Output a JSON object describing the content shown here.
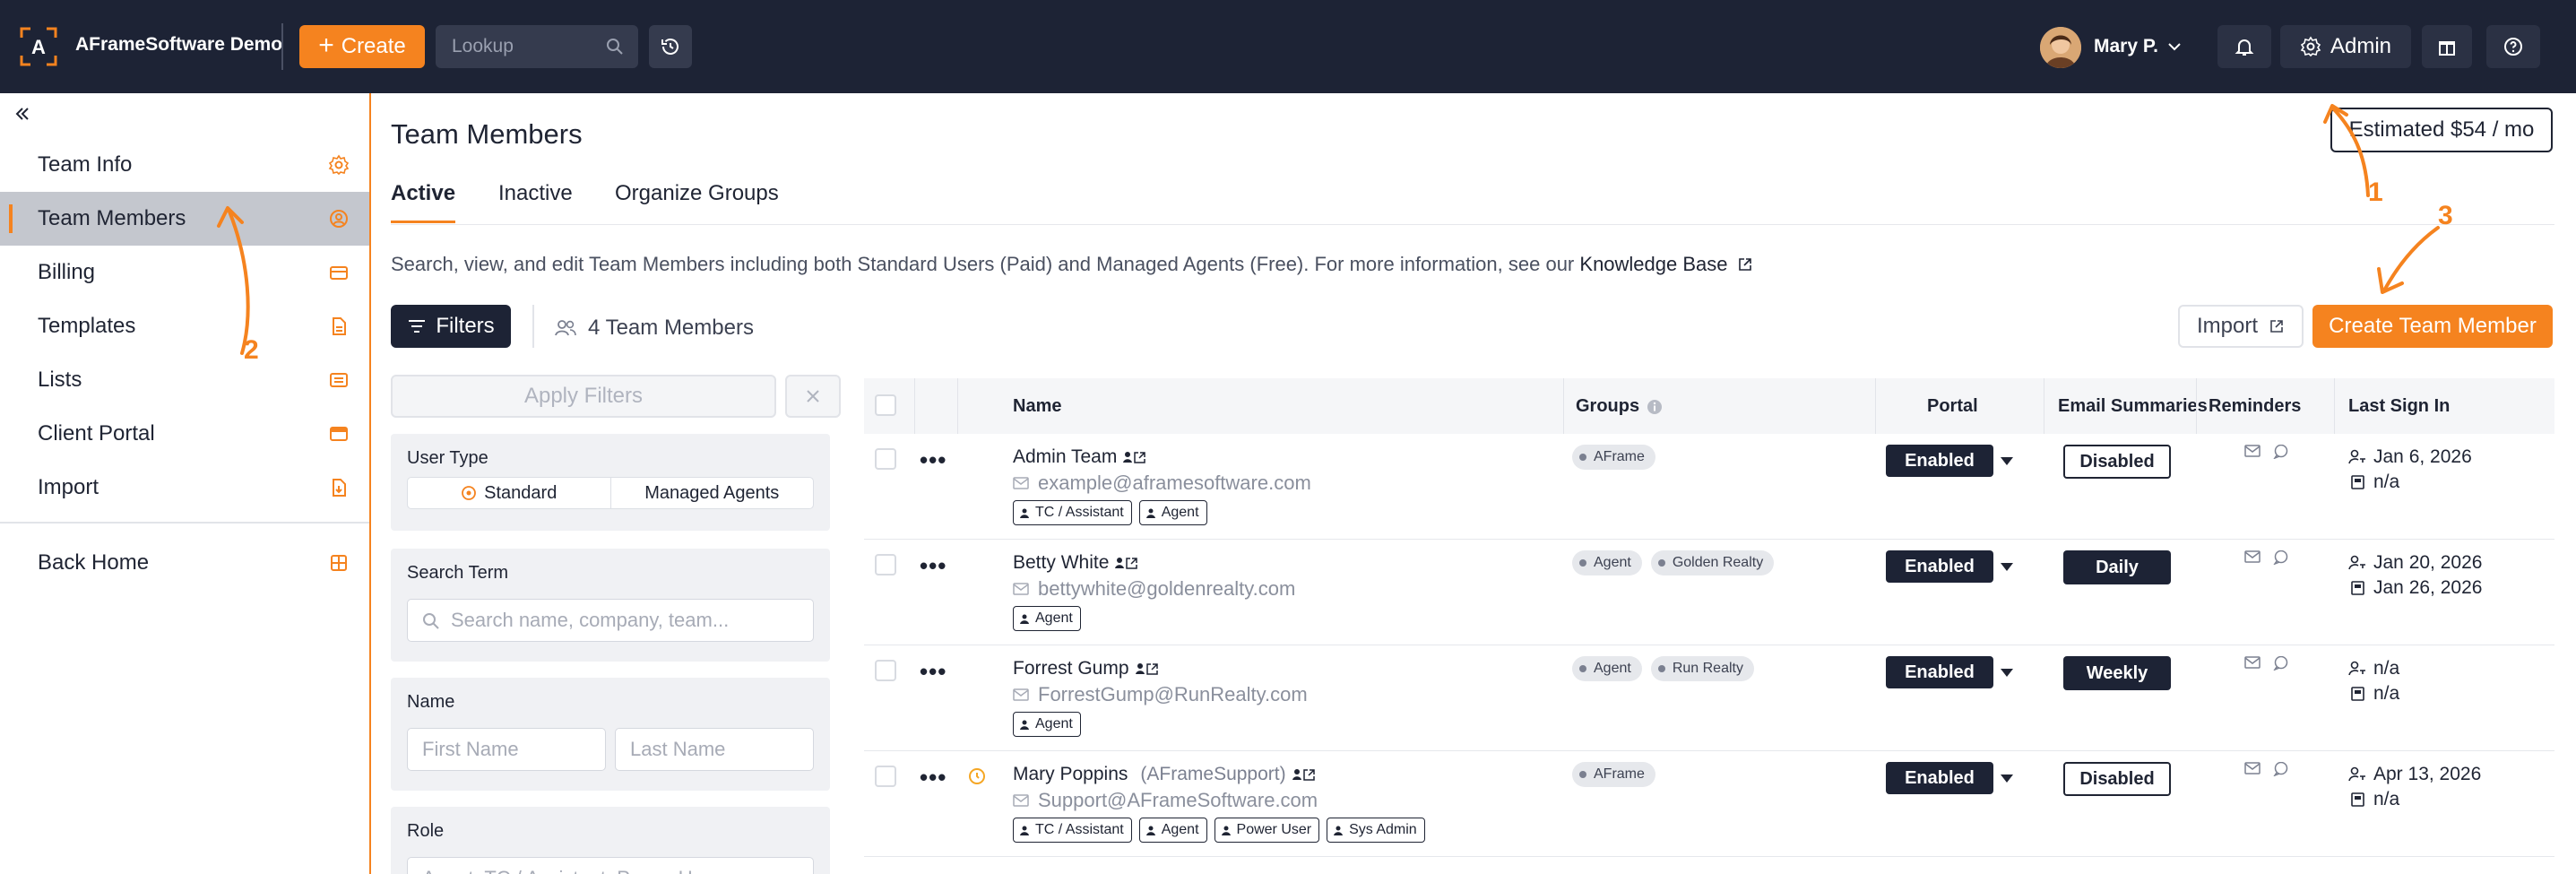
{
  "topbar": {
    "brand": "AFrameSoftware Demo",
    "create_label": "Create",
    "lookup_placeholder": "Lookup",
    "user_name": "Mary P.",
    "admin_label": "Admin"
  },
  "sidebar": {
    "items": [
      {
        "label": "Team Info",
        "icon": "gear-icon"
      },
      {
        "label": "Team Members",
        "icon": "user-circle-icon",
        "active": true
      },
      {
        "label": "Billing",
        "icon": "credit-card-icon"
      },
      {
        "label": "Templates",
        "icon": "document-icon"
      },
      {
        "label": "Lists",
        "icon": "list-icon"
      },
      {
        "label": "Client Portal",
        "icon": "portal-card-icon"
      },
      {
        "label": "Import",
        "icon": "import-file-icon"
      }
    ],
    "back_home": "Back Home"
  },
  "page": {
    "title": "Team Members",
    "estimate": "Estimated $54 / mo",
    "tabs": [
      "Active",
      "Inactive",
      "Organize Groups"
    ],
    "description": "Search, view, and edit Team Members including both Standard Users (Paid) and Managed Agents (Free). For more information, see our",
    "kb_link": "Knowledge Base",
    "filters_label": "Filters",
    "member_count": "4 Team Members",
    "import_label": "Import",
    "create_member_label": "Create Team Member"
  },
  "filters": {
    "apply_label": "Apply Filters",
    "user_type_label": "User Type",
    "user_type_options": [
      "Standard",
      "Managed Agents"
    ],
    "search_term_label": "Search Term",
    "search_placeholder": "Search name, company, team...",
    "name_label": "Name",
    "first_name_placeholder": "First Name",
    "last_name_placeholder": "Last Name",
    "role_label": "Role",
    "role_value": "Agent, TC / Assistant, Power User, ..."
  },
  "table": {
    "headers": {
      "name": "Name",
      "groups": "Groups",
      "portal": "Portal",
      "email_summaries": "Email Summaries",
      "reminders": "Reminders",
      "last_sign_in": "Last Sign In"
    },
    "rows": [
      {
        "name": "Admin Team",
        "sub": "",
        "email": "example@aframesoftware.com",
        "roles": [
          "TC / Assistant",
          "Agent"
        ],
        "groups": [
          "AFrame"
        ],
        "portal": "Enabled",
        "email_summary": "Disabled",
        "email_summary_style": "outline",
        "sign_in": "Jan 6, 2026",
        "login": "n/a",
        "warning": false
      },
      {
        "name": "Betty White",
        "sub": "",
        "email": "bettywhite@goldenrealty.com",
        "roles": [
          "Agent"
        ],
        "groups": [
          "Agent",
          "Golden Realty"
        ],
        "portal": "Enabled",
        "email_summary": "Daily",
        "email_summary_style": "filled",
        "sign_in": "Jan 20, 2026",
        "login": "Jan 26, 2026",
        "warning": false
      },
      {
        "name": "Forrest Gump",
        "sub": "",
        "email": "ForrestGump@RunRealty.com",
        "roles": [
          "Agent"
        ],
        "groups": [
          "Agent",
          "Run Realty"
        ],
        "portal": "Enabled",
        "email_summary": "Weekly",
        "email_summary_style": "filled",
        "sign_in": "n/a",
        "login": "n/a",
        "warning": false
      },
      {
        "name": "Mary Poppins",
        "sub": "(AFrameSupport)",
        "email": "Support@AFrameSoftware.com",
        "roles": [
          "TC / Assistant",
          "Agent",
          "Power User",
          "Sys Admin"
        ],
        "groups": [
          "AFrame"
        ],
        "portal": "Enabled",
        "email_summary": "Disabled",
        "email_summary_style": "outline",
        "sign_in": "Apr 13, 2026",
        "login": "n/a",
        "warning": true
      }
    ]
  },
  "annotations": [
    "1",
    "2",
    "3"
  ],
  "colors": {
    "accent": "#f5831f",
    "navy": "#1d2335"
  }
}
